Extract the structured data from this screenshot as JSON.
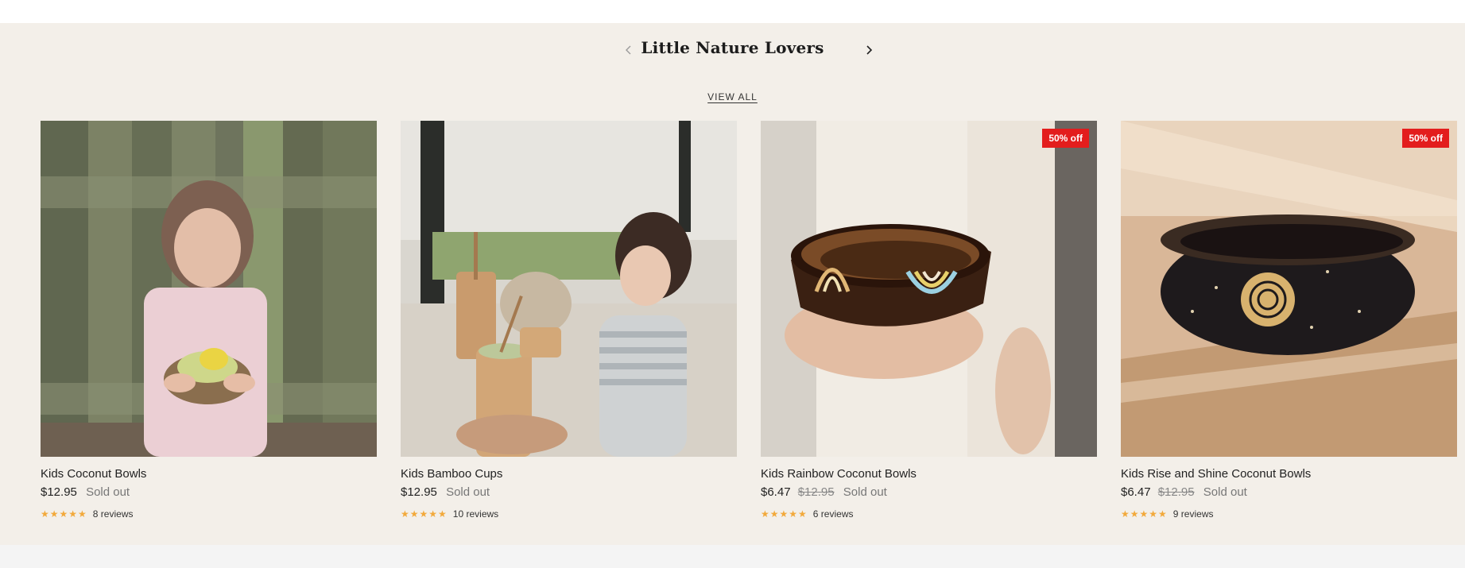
{
  "section": {
    "title": "Little Nature Lovers",
    "view_all_label": "VIEW ALL",
    "prev_icon": "chevron-left-icon",
    "next_icon": "chevron-right-icon"
  },
  "products": [
    {
      "name": "Kids Coconut Bowls",
      "price": "$12.95",
      "compare_price": "",
      "status": "Sold out",
      "badge": "",
      "stars": "★★★★★",
      "reviews": "8 reviews",
      "rating": 5
    },
    {
      "name": "Kids Bamboo Cups",
      "price": "$12.95",
      "compare_price": "",
      "status": "Sold out",
      "badge": "",
      "stars": "★★★★★",
      "reviews": "10 reviews",
      "rating": 5
    },
    {
      "name": "Kids Rainbow Coconut Bowls",
      "price": "$6.47",
      "compare_price": "$12.95",
      "status": "Sold out",
      "badge": "50% off",
      "stars": "★★★★★",
      "reviews": "6 reviews",
      "rating": 5
    },
    {
      "name": "Kids Rise and Shine Coconut Bowls",
      "price": "$6.47",
      "compare_price": "$12.95",
      "status": "Sold out",
      "badge": "50% off",
      "stars": "★★★★★",
      "reviews": "9 reviews",
      "rating": 5
    }
  ],
  "colors": {
    "section_bg": "#f3efe9",
    "badge_bg": "#e31d1d",
    "star": "#f2a93b"
  }
}
